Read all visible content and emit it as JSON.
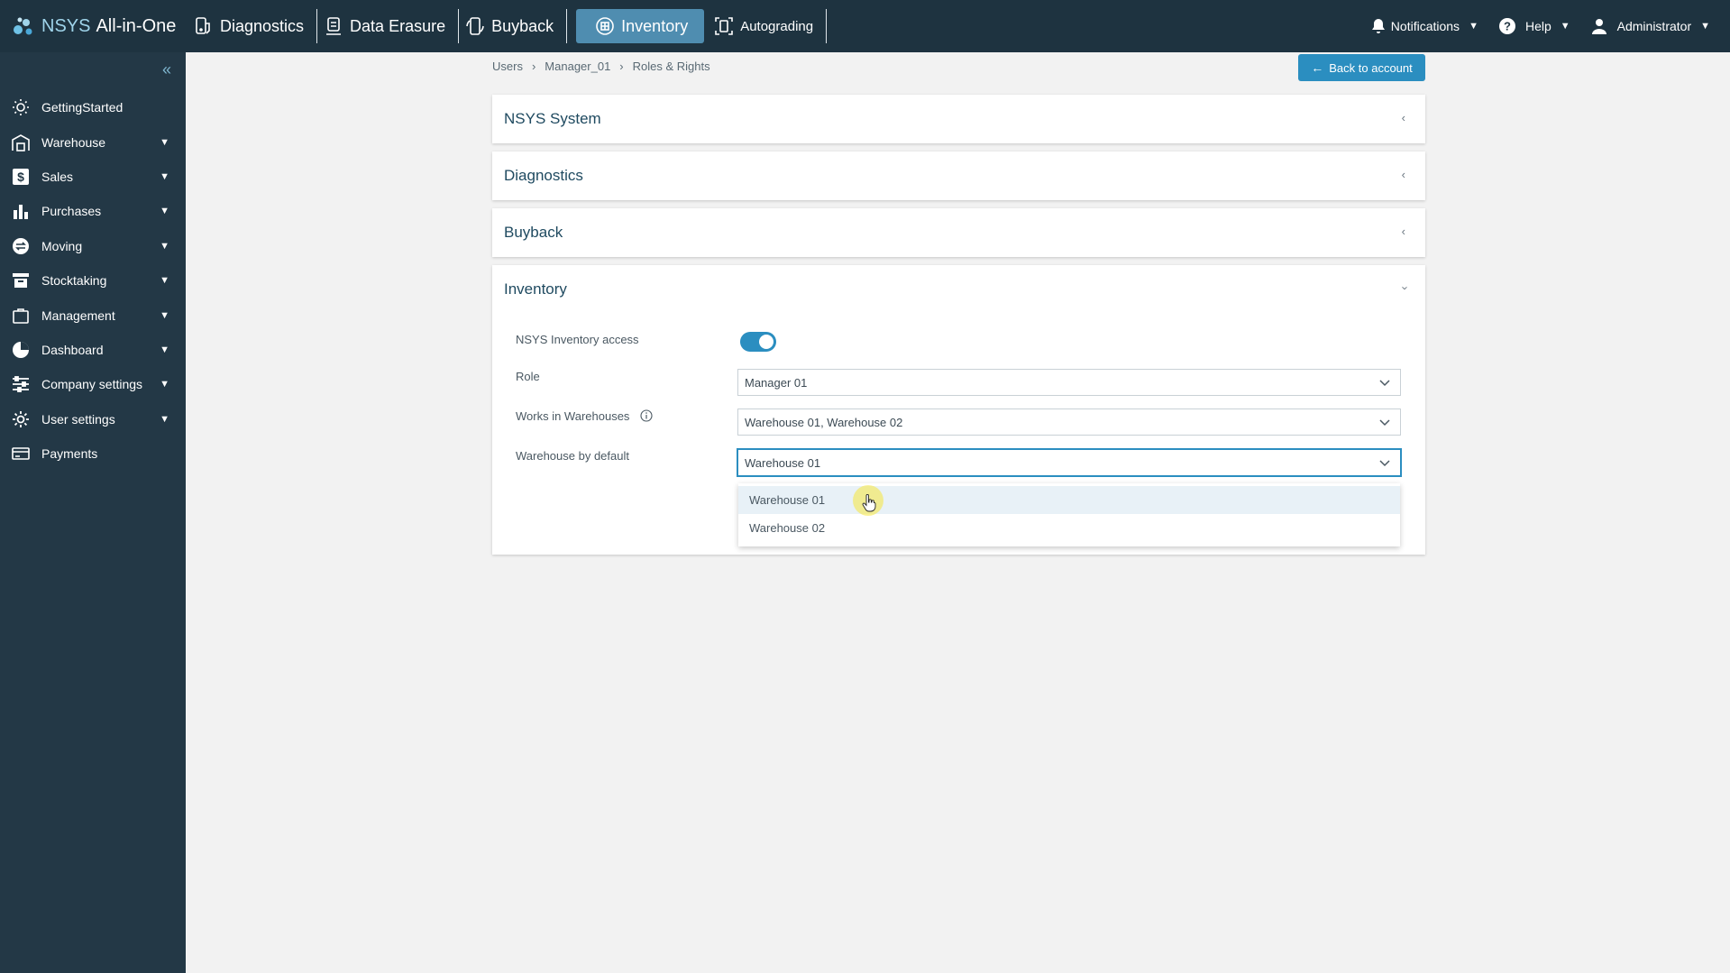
{
  "app": {
    "brand_prefix": "NSYS",
    "brand_name": "All-in-One"
  },
  "topnav": [
    {
      "label": "Diagnostics",
      "icon": "diagnostics-icon"
    },
    {
      "label": "Data Erasure",
      "icon": "data-erasure-icon"
    },
    {
      "label": "Buyback",
      "icon": "buyback-icon"
    },
    {
      "label": "Inventory",
      "icon": "inventory-icon",
      "active": true
    },
    {
      "label": "Autograding",
      "icon": "autograding-icon"
    }
  ],
  "topright": {
    "notifications": "Notifications",
    "help": "Help",
    "user": "Administrator"
  },
  "sidebar": {
    "items": [
      {
        "label": "GettingStarted",
        "icon": "bulb-icon",
        "expandable": false
      },
      {
        "label": "Warehouse",
        "icon": "warehouse-icon",
        "expandable": true
      },
      {
        "label": "Sales",
        "icon": "dollar-icon",
        "expandable": true
      },
      {
        "label": "Purchases",
        "icon": "bar-chart-icon",
        "expandable": true
      },
      {
        "label": "Moving",
        "icon": "moving-icon",
        "expandable": true
      },
      {
        "label": "Stocktaking",
        "icon": "stocktaking-icon",
        "expandable": true
      },
      {
        "label": "Management",
        "icon": "folder-icon",
        "expandable": true
      },
      {
        "label": "Dashboard",
        "icon": "pie-icon",
        "expandable": true
      },
      {
        "label": "Company settings",
        "icon": "sliders-icon",
        "expandable": true
      },
      {
        "label": "User settings",
        "icon": "gear-icon",
        "expandable": true
      },
      {
        "label": "Payments",
        "icon": "card-icon",
        "expandable": false
      }
    ]
  },
  "breadcrumb": [
    "Users",
    "Manager_01",
    "Roles & Rights"
  ],
  "back_button": "Back to account",
  "panels": {
    "nsys_system": "NSYS System",
    "diagnostics": "Diagnostics",
    "buyback": "Buyback",
    "inventory": "Inventory"
  },
  "inventory_form": {
    "access_label": "NSYS Inventory access",
    "access_enabled": true,
    "role_label": "Role",
    "role_value": "Manager 01",
    "works_label": "Works in Warehouses",
    "works_value": "Warehouse 01, Warehouse 02",
    "default_label": "Warehouse by default",
    "default_value": "Warehouse 01",
    "options": [
      "Warehouse 01",
      "Warehouse 02"
    ]
  },
  "colors": {
    "topbar": "#1e3340",
    "sidebar": "#233846",
    "accent": "#2b8ec0",
    "active_tab": "#4f8db0"
  }
}
